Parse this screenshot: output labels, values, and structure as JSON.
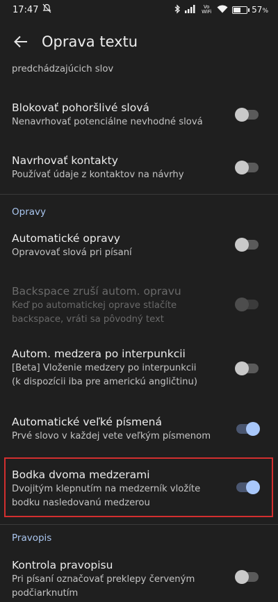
{
  "status_bar": {
    "time": "17:47",
    "vowifi": "Vo WiFi",
    "battery": "57",
    "battery_unit": "%",
    "battery_level": 0.57
  },
  "app_bar": {
    "title": "Oprava textu"
  },
  "previous_summary_tail": "predchádzajúcich slov",
  "settings": {
    "block_offensive": {
      "title": "Blokovať pohoršlivé slová",
      "summary": "Nenavrhovať potenciálne nevhodné slová",
      "checked": false
    },
    "suggest_contacts": {
      "title": "Navrhovať kontakty",
      "summary": "Používať údaje z kontaktov na návrhy",
      "checked": false
    },
    "auto_correction": {
      "title": "Automatické opravy",
      "summary": "Opravovať slová pri písaní",
      "checked": false
    },
    "backspace_undo": {
      "title": "Backspace zruší autom. opravu",
      "summary_line1": "Keď po automatickej oprave stlačíte",
      "summary_line2": "backspace, vráti sa pôvodný text",
      "checked": false,
      "enabled": false
    },
    "auto_space": {
      "title": "Autom. medzera po interpunkcii",
      "summary_line1": "[Beta] Vloženie medzery po interpunkcii",
      "summary_line2": "(k dispozícii iba pre americkú angličtinu)",
      "checked": false
    },
    "auto_caps": {
      "title": "Automatické veľké písmená",
      "summary": "Prvé slovo v každej vete veľkým písmenom",
      "checked": true
    },
    "double_space_period": {
      "title": "Bodka dvoma medzerami",
      "summary_line1": "Dvojitým klepnutím na medzerník vložíte",
      "summary_line2": "bodku nasledovanú medzerou",
      "checked": true
    },
    "spell_check": {
      "title": "Kontrola pravopisu",
      "summary_line1": "Pri písaní označovať preklepy červeným",
      "summary_line2": "podčiarknutím",
      "checked": false
    }
  },
  "sections": {
    "corrections": "Opravy",
    "spelling": "Pravopis"
  },
  "colors": {
    "background": "#1f1f1f",
    "accent": "#a8c7fa",
    "section_header": "#a9c5ee",
    "highlight_border": "#d32f2f"
  }
}
